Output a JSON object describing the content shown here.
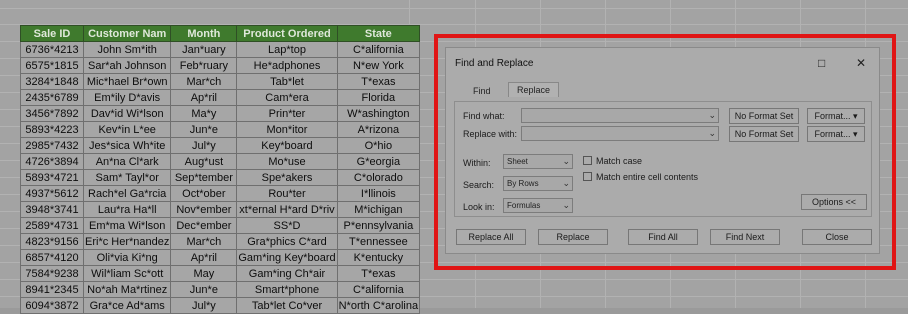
{
  "sheet": {
    "headers": [
      "Sale ID",
      "Customer Nam",
      "Month",
      "Product Ordered",
      "State"
    ],
    "rows": [
      [
        "6736*4213",
        "John Sm*ith",
        "Jan*uary",
        "Lap*top",
        "C*alifornia"
      ],
      [
        "6575*1815",
        "Sar*ah Johnson",
        "Feb*ruary",
        "He*adphones",
        "N*ew York"
      ],
      [
        "3284*1848",
        "Mic*hael Br*own",
        "Mar*ch",
        "Tab*let",
        "T*exas"
      ],
      [
        "2435*6789",
        "Em*ily D*avis",
        "Ap*ril",
        "Cam*era",
        "Florida"
      ],
      [
        "3456*7892",
        "Dav*id Wi*lson",
        "Ma*y",
        "Prin*ter",
        "W*ashington"
      ],
      [
        "5893*4223",
        "Kev*in L*ee",
        "Jun*e",
        "Mon*itor",
        "A*rizona"
      ],
      [
        "2985*7432",
        "Jes*sica Wh*ite",
        "Jul*y",
        "Key*board",
        "O*hio"
      ],
      [
        "4726*3894",
        "An*na Cl*ark",
        "Aug*ust",
        "Mo*use",
        "G*eorgia"
      ],
      [
        "5893*4721",
        "Sam* Tayl*or",
        "Sep*tember",
        "Spe*akers",
        "C*olorado"
      ],
      [
        "4937*5612",
        "Rach*el Ga*rcia",
        "Oct*ober",
        "Rou*ter",
        "I*llinois"
      ],
      [
        "3948*3741",
        "Lau*ra Ha*ll",
        "Nov*ember",
        "xt*ernal H*ard D*riv",
        "M*ichigan"
      ],
      [
        "2589*4731",
        "Em*ma Wi*lson",
        "Dec*ember",
        "SS*D",
        "P*ennsylvania"
      ],
      [
        "4823*9156",
        "Eri*c Her*nandez",
        "Mar*ch",
        "Gra*phics C*ard",
        "T*ennessee"
      ],
      [
        "6857*4120",
        "Oli*via Ki*ng",
        "Ap*ril",
        "Gam*ing Key*board",
        "K*entucky"
      ],
      [
        "7584*9238",
        "Wil*liam Sc*ott",
        "May",
        "Gam*ing Ch*air",
        "T*exas"
      ],
      [
        "8941*2345",
        "No*ah Ma*rtinez",
        "Jun*e",
        "Smart*phone",
        "C*alifornia"
      ],
      [
        "6094*3872",
        "Gra*ce Ad*ams",
        "Jul*y",
        "Tab*let Co*ver",
        "N*orth C*arolina"
      ]
    ]
  },
  "dialog": {
    "title": "Find and Replace",
    "maximize_icon": "□",
    "close_icon": "✕",
    "tabs": [
      "Find",
      "Replace"
    ],
    "find_label": "Find what:",
    "replace_label": "Replace with:",
    "no_format_1": "No Format Set",
    "no_format_2": "No Format Set",
    "format_1": "Format...",
    "format_2": "Format...",
    "within_label": "Within:",
    "within_value": "Sheet",
    "search_label": "Search:",
    "search_value": "By Rows",
    "lookin_label": "Look in:",
    "lookin_value": "Formulas",
    "match_case": "Match case",
    "match_entire": "Match entire cell contents",
    "options": "Options <<",
    "buttons": [
      "Replace All",
      "Replace",
      "Find All",
      "Find Next",
      "Close"
    ]
  }
}
